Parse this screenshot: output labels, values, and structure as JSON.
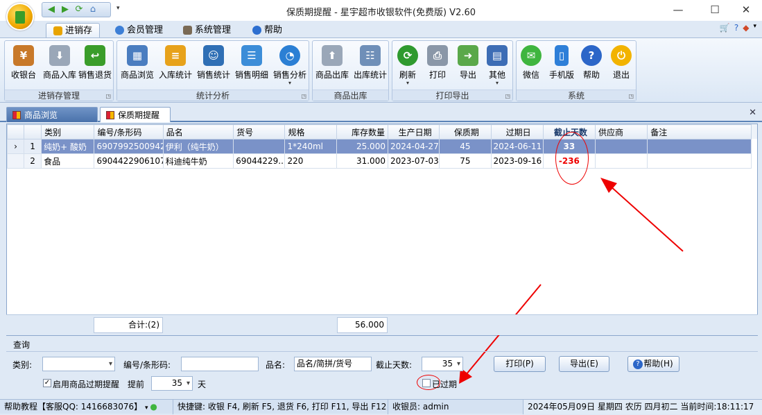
{
  "window": {
    "title": "保质期提醒 - 星宇超市收银软件(免费版) V2.60"
  },
  "ribbon_tabs": [
    {
      "label": "进销存",
      "color": "#e8a400"
    },
    {
      "label": "会员管理",
      "color": "#3d7fd6"
    },
    {
      "label": "系统管理",
      "color": "#7a6a55"
    },
    {
      "label": "帮助",
      "color": "#2d6fd0"
    }
  ],
  "ribbon_groups": [
    {
      "title": "进销存管理",
      "buttons": [
        {
          "label": "收银台",
          "icon": "cashier-icon",
          "color": "#c8792a"
        },
        {
          "label": "商品入库",
          "icon": "stock-in-icon",
          "color": "#9aa7b8"
        },
        {
          "label": "销售退货",
          "icon": "return-icon",
          "color": "#3a9d2a"
        }
      ]
    },
    {
      "title": "统计分析",
      "buttons": [
        {
          "label": "商品浏览",
          "icon": "browse-icon",
          "color": "#4a7dc0"
        },
        {
          "label": "入库统计",
          "icon": "stock-stats-icon",
          "color": "#e7a21b"
        },
        {
          "label": "销售统计",
          "icon": "sales-stats-icon",
          "color": "#2f6fb5"
        },
        {
          "label": "销售明细",
          "icon": "sales-detail-icon",
          "color": "#3c8dd8"
        },
        {
          "label": "销售分析",
          "icon": "pie-chart-icon",
          "color": "#2b7fd4",
          "dropdown": true
        }
      ]
    },
    {
      "title": "商品出库",
      "buttons": [
        {
          "label": "商品出库",
          "icon": "stock-out-icon",
          "color": "#9aa7b8"
        },
        {
          "label": "出库统计",
          "icon": "out-stats-icon",
          "color": "#6f8fb8"
        }
      ]
    },
    {
      "title": "打印导出",
      "buttons": [
        {
          "label": "刷新",
          "icon": "refresh-icon",
          "color": "#2f9a2f",
          "dropdown": true
        },
        {
          "label": "打印",
          "icon": "printer-icon",
          "color": "#8a97a8"
        },
        {
          "label": "导出",
          "icon": "export-icon",
          "color": "#5aa84a"
        },
        {
          "label": "其他",
          "icon": "grid-icon",
          "color": "#3d6db5",
          "dropdown": true
        }
      ]
    },
    {
      "title": "系统",
      "buttons": [
        {
          "label": "微信",
          "icon": "wechat-icon",
          "color": "#3fb53f"
        },
        {
          "label": "手机版",
          "icon": "phone-icon",
          "color": "#2e7fd8"
        },
        {
          "label": "帮助",
          "icon": "help-icon",
          "color": "#2c66c8"
        },
        {
          "label": "退出",
          "icon": "power-icon",
          "color": "#f2b300"
        }
      ]
    }
  ],
  "doc_tabs": [
    {
      "label": "商品浏览"
    },
    {
      "label": "保质期提醒"
    }
  ],
  "grid": {
    "columns": [
      "类别",
      "编号/条形码",
      "品名",
      "货号",
      "规格",
      "库存数量",
      "生产日期",
      "保质期",
      "过期日",
      "截止天数",
      "供应商",
      "备注"
    ],
    "rows": [
      {
        "idx": "1",
        "marker": "›",
        "cells": [
          "纯奶+ 酸奶",
          "6907992500942",
          "伊利（纯牛奶）",
          "",
          "1*240ml",
          "25.000",
          "2024-04-27",
          "45",
          "2024-06-11",
          "33",
          "",
          ""
        ]
      },
      {
        "idx": "2",
        "marker": "",
        "cells": [
          "食品",
          "6904422906107",
          "科迪纯牛奶",
          "69044229...",
          "220",
          "31.000",
          "2023-07-03",
          "75",
          "2023-09-16",
          "-236",
          "",
          ""
        ]
      }
    ],
    "footer": {
      "count": "合计:(2)",
      "total_qty": "56.000"
    }
  },
  "query": {
    "section_label": "查询",
    "category_label": "类别:",
    "category_value": "",
    "barcode_label": "编号/条形码:",
    "barcode_value": "",
    "name_label": "品名:",
    "name_placeholder": "品名/简拼/货号",
    "days_label": "截止天数:",
    "days_value": "35",
    "print_button": "打印(P)",
    "export_button": "导出(E)",
    "help_button": "帮助(H)",
    "enable_label": "启用商品过期提醒",
    "enable_checked": true,
    "advance_label": "提前",
    "advance_value": "35",
    "advance_unit": "天",
    "expired_label": "已过期",
    "expired_checked": false
  },
  "status": {
    "help": "帮助教程【客服QQ: 1416683076】",
    "shortcuts": "快捷键: 收银 F4, 刷新 F5, 退货 F6, 打印 F11, 导出 F12",
    "cashier": "收银员: admin",
    "datetime": "2024年05月09日 星期四 农历 四月初二 当前时间:18:11:17"
  }
}
